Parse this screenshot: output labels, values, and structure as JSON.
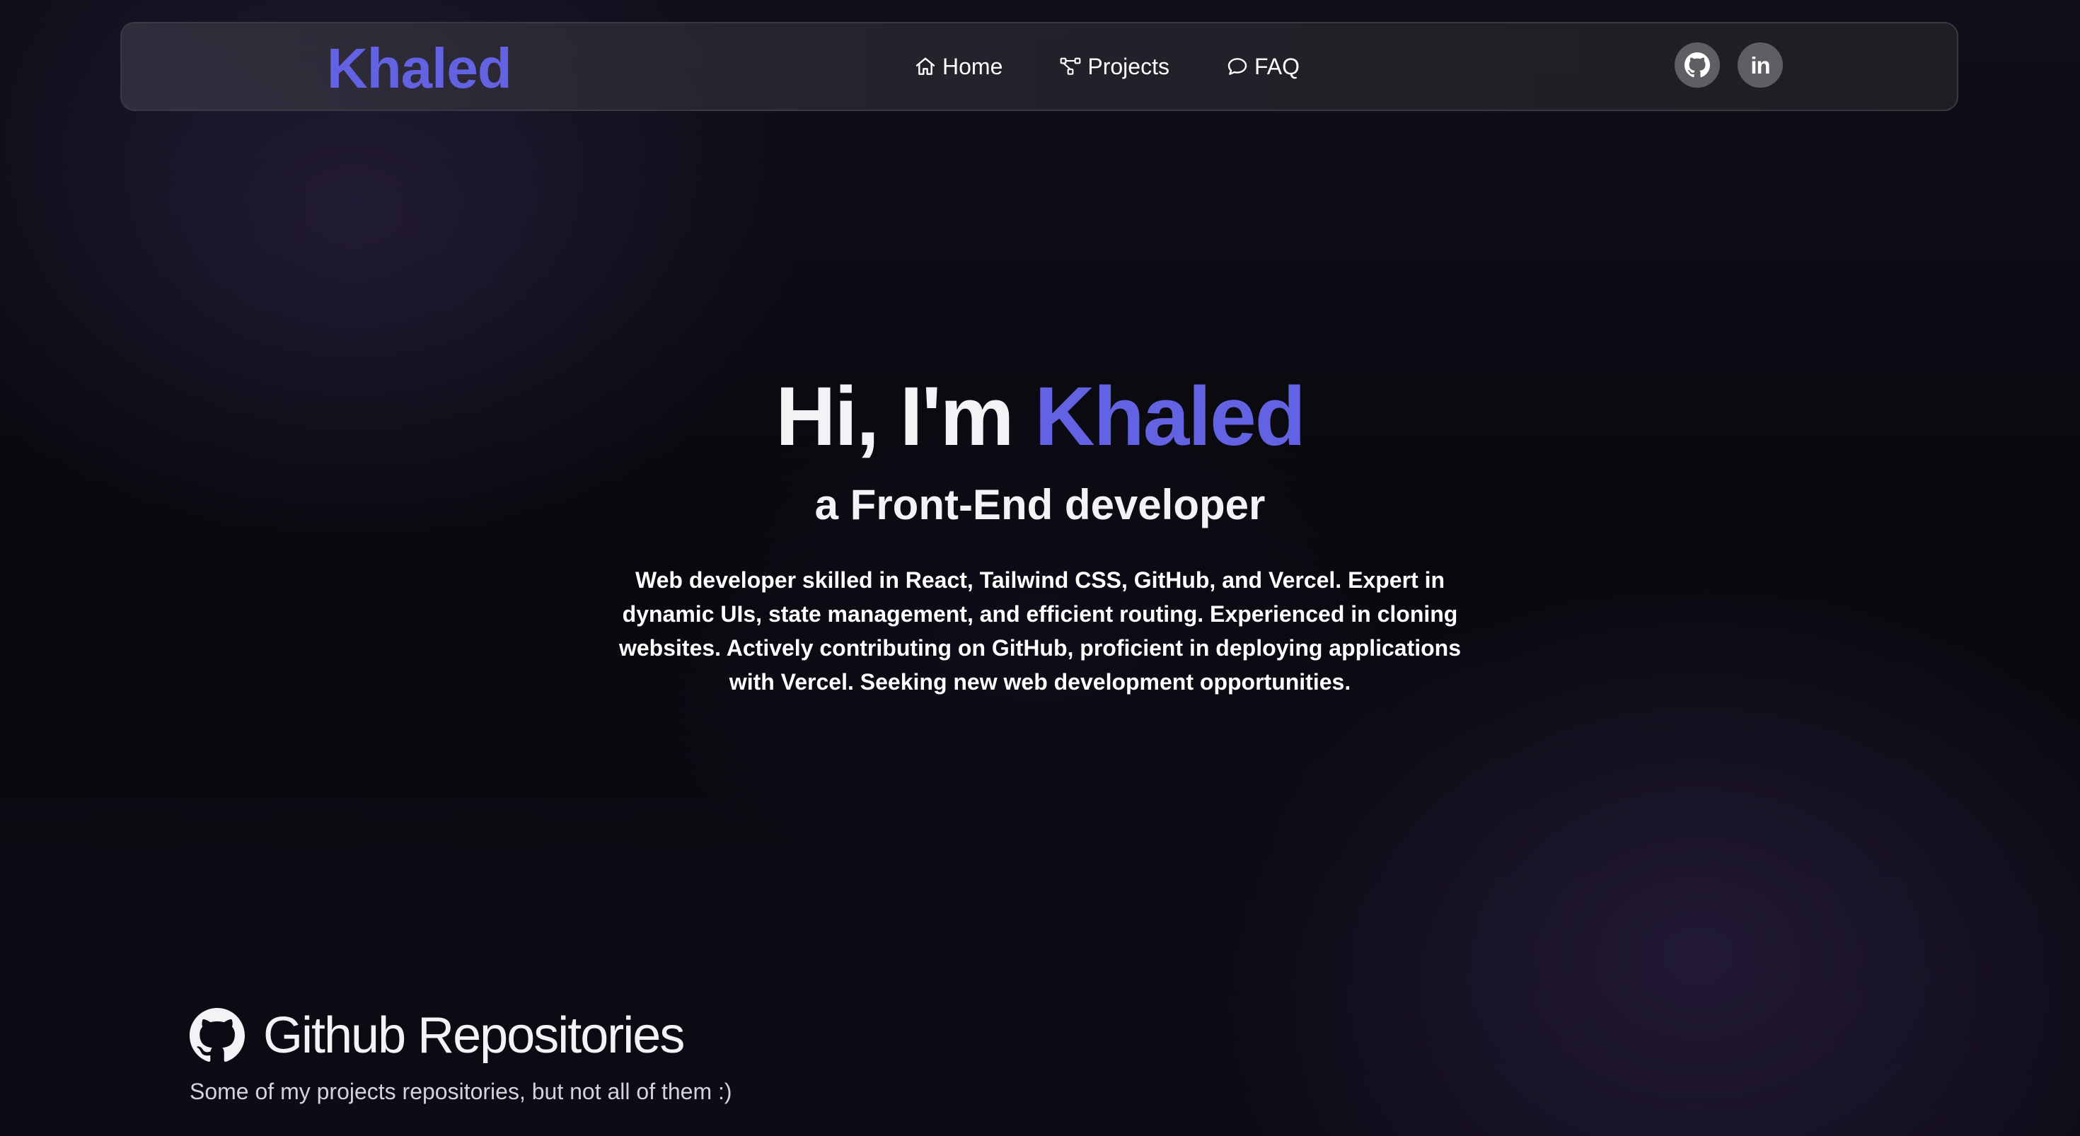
{
  "nav": {
    "brand": "Khaled",
    "links": [
      {
        "label": "Home",
        "icon": "home-icon"
      },
      {
        "label": "Projects",
        "icon": "project-diagram-icon"
      },
      {
        "label": "FAQ",
        "icon": "chat-bubble-icon"
      }
    ],
    "social": [
      {
        "name": "github",
        "icon": "github-icon"
      },
      {
        "name": "linkedin",
        "icon": "linkedin-icon",
        "text": "in"
      }
    ]
  },
  "hero": {
    "greeting": "Hi, I'm",
    "name": "Khaled",
    "subtitle": "a Front-End developer",
    "description": "Web developer skilled in React, Tailwind CSS, GitHub, and Vercel. Expert in dynamic UIs, state management, and efficient routing. Experienced in cloning websites. Actively contributing on GitHub, proficient in deploying applications with Vercel. Seeking new web development opportunities."
  },
  "repos": {
    "icon": "github-icon",
    "title": "Github Repositories",
    "subtitle": "Some of my projects repositories, but not all of them :)"
  },
  "colors": {
    "accent": "#6262e2",
    "text": "#f3f3f6",
    "social_bg": "#5e5e63"
  }
}
